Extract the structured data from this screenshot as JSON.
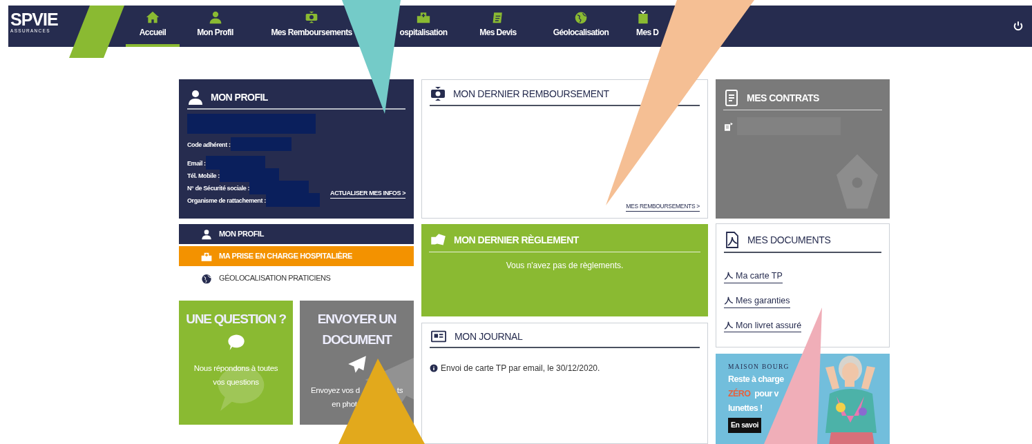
{
  "header": {
    "logo": "SPVIE",
    "logo_subtitle": "ASSURANCES",
    "nav": [
      {
        "label": "Accueil",
        "selected": true,
        "kind": "home"
      },
      {
        "label": "Mon Profil",
        "selected": false,
        "kind": "person"
      },
      {
        "label": "Mes Remboursements",
        "selected": false,
        "kind": "money"
      },
      {
        "label": "ospitalisation",
        "selected": false,
        "kind": "hospital"
      },
      {
        "label": "Mes Devis",
        "selected": false,
        "kind": "quote"
      },
      {
        "label": "Géolocalisation",
        "selected": false,
        "kind": "globe"
      },
      {
        "label": "Mes D",
        "selected": false,
        "kind": "docs"
      }
    ]
  },
  "profile_card": {
    "title": "MON PROFIL",
    "fields": [
      "Code adhérent :",
      "Email :",
      "Tél. Mobile :",
      "N° de Sécurité sociale :",
      "Organisme de rattachement :"
    ],
    "link": "ACTUALISER MES INFOS >"
  },
  "side_menu": [
    {
      "label": "MON PROFIL",
      "kind": "dark"
    },
    {
      "label": "MA PRISE EN CHARGE HOSPITALIÈRE",
      "kind": "orange"
    },
    {
      "label": "GÉOLOCALISATION PRATICIENS",
      "kind": "plain"
    }
  ],
  "tiles": [
    {
      "kind": "question",
      "title": "UNE QUESTION ?",
      "lines": [
        [
          "Nous répondons à toutes"
        ],
        [
          "vos questions"
        ]
      ]
    },
    {
      "kind": "send",
      "title": "ENVOYER UN DOCUMENT",
      "lines": [
        [
          "Envoyez vos d",
          "ts"
        ],
        [
          "en phot"
        ]
      ]
    }
  ],
  "reimbursement": {
    "title": "MON DERNIER REMBOURSEMENT",
    "link": "MES REMBOURSEMENTS >"
  },
  "settlement": {
    "title": "MON DERNIER RÈGLEMENT",
    "message": "Vous n'avez pas de règlements."
  },
  "journal": {
    "title": "MON JOURNAL",
    "entries": [
      "Envoi de carte TP par email, le 30/12/2020."
    ]
  },
  "contracts": {
    "title": "MES CONTRATS"
  },
  "documents": {
    "title": "MES DOCUMENTS",
    "links": [
      "Ma carte TP",
      "Mes garanties",
      "Mon livret assuré"
    ]
  },
  "ad": {
    "brand": "MAISON BOURG",
    "line1": "Reste à charge",
    "highlight": "ZÉRO",
    "line2": "pour v",
    "line3": "lunettes !",
    "button": "En savoi"
  },
  "callouts": [
    {
      "color": "#74cbc8"
    },
    {
      "color": "#f5bf94"
    },
    {
      "color": "#e2a91c"
    },
    {
      "color": "#f0aeb8"
    }
  ]
}
